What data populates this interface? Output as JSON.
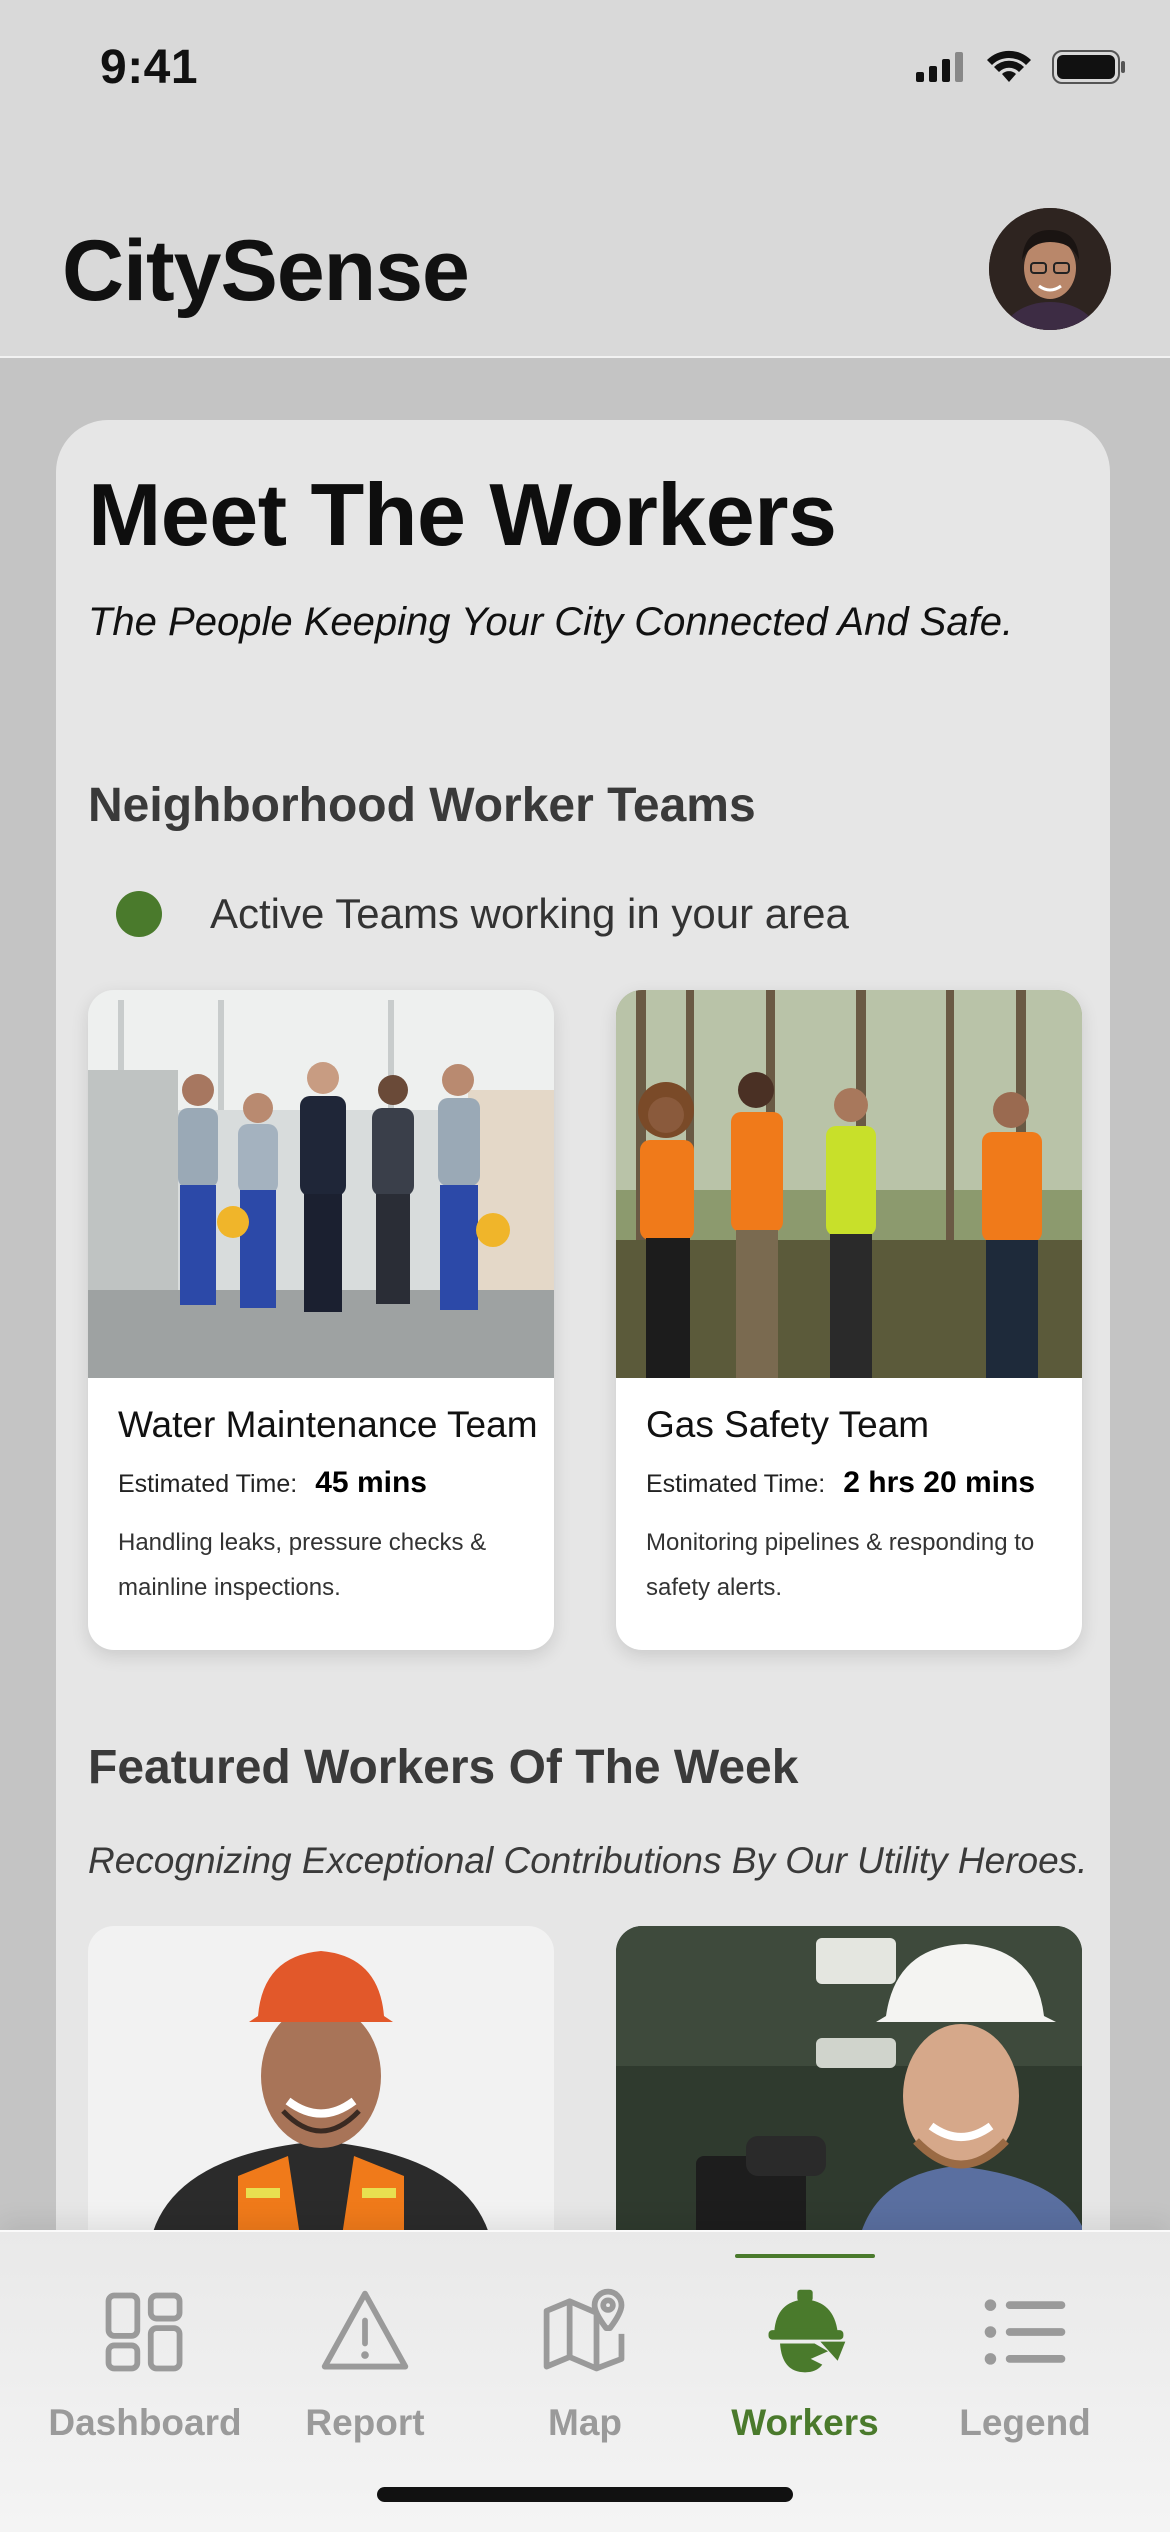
{
  "status_bar": {
    "time": "9:41"
  },
  "header": {
    "app_title": "CitySense",
    "avatar_icon": "user-avatar"
  },
  "main": {
    "title": "Meet The Workers",
    "subtitle": "The People Keeping Your City Connected And Safe.",
    "teams_section": {
      "title": "Neighborhood Worker Teams",
      "active_text": "Active Teams working in your area",
      "active_color": "#4a7a2c",
      "estimated_label": "Estimated Time:",
      "teams": [
        {
          "name": "Water Maintenance Team",
          "time": "45 mins",
          "description": "Handling leaks, pressure checks & mainline inspections."
        },
        {
          "name": "Gas Safety Team",
          "time": "2 hrs 20 mins",
          "description": "Monitoring pipelines & responding to safety alerts."
        }
      ]
    },
    "featured_section": {
      "title": "Featured Workers Of The Week",
      "subtitle": "Recognizing Exceptional Contributions By Our Utility Heroes."
    }
  },
  "tabbar": {
    "accent_color": "#4a7a2c",
    "inactive_color": "#9a9a9a",
    "tabs": [
      {
        "label": "Dashboard",
        "icon": "dashboard-icon",
        "active": false
      },
      {
        "label": "Report",
        "icon": "warning-icon",
        "active": false
      },
      {
        "label": "Map",
        "icon": "map-icon",
        "active": false
      },
      {
        "label": "Workers",
        "icon": "hardhat-icon",
        "active": true
      },
      {
        "label": "Legend",
        "icon": "list-icon",
        "active": false
      }
    ]
  }
}
